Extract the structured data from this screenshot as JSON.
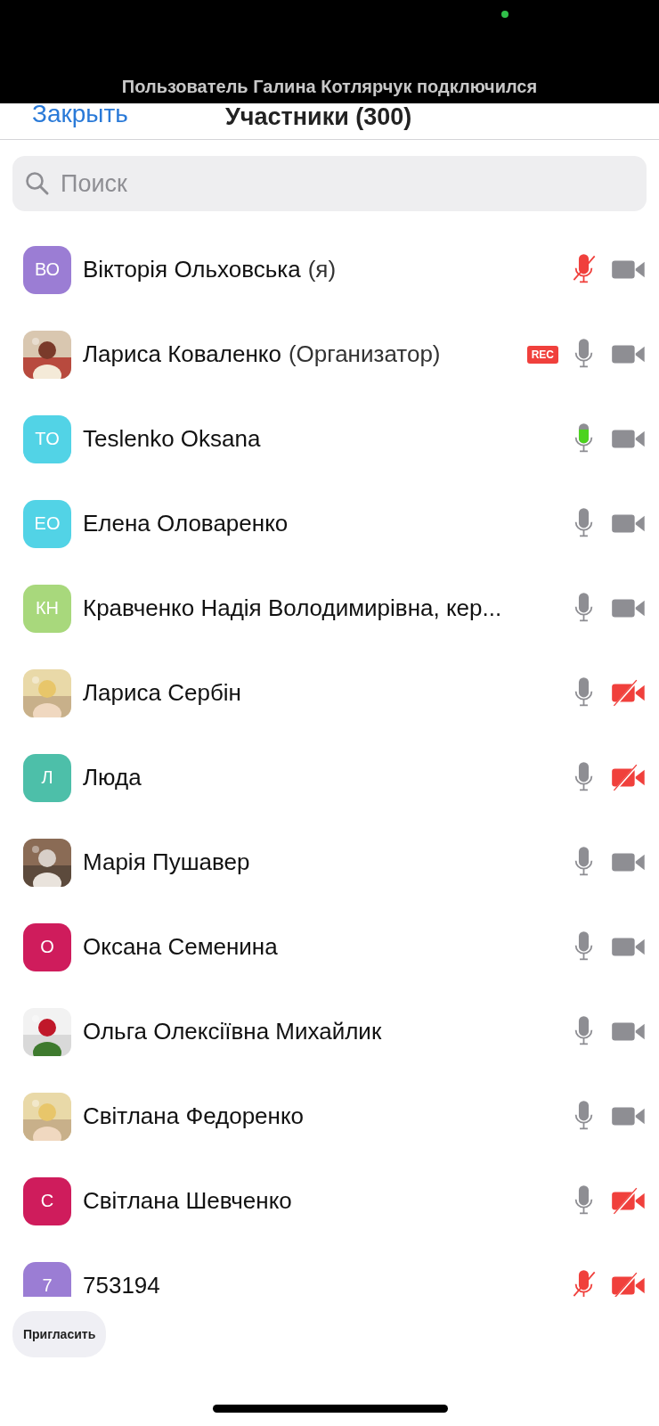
{
  "notification": {
    "text": "Пользователь Галина Котлярчук подключился"
  },
  "header": {
    "close": "Закрыть",
    "title": "Участники (300)"
  },
  "search": {
    "placeholder": "Поиск"
  },
  "participants": [
    {
      "avatar": {
        "kind": "initials",
        "text": "ВО",
        "color": "#9b7dd4"
      },
      "name": "Вікторія Ольховська",
      "role": "(я)",
      "recording": false,
      "muted": true,
      "talking": false,
      "video_on": true
    },
    {
      "name": "Лариса Коваленко",
      "role": "(Организатор)",
      "recording": true,
      "badge": "REC",
      "muted": false,
      "talking": false,
      "video_on": true
    },
    {
      "avatar": {
        "kind": "initials",
        "text": "TO",
        "color": "#52d3e6"
      },
      "name": "Teslenko Oksana",
      "recording": false,
      "muted": false,
      "talking": true,
      "video_on": true
    },
    {
      "avatar": {
        "kind": "initials",
        "text": "ЕО",
        "color": "#52d3e6"
      },
      "name": "Елена Оловаренко",
      "recording": false,
      "muted": false,
      "talking": false,
      "video_on": true
    },
    {
      "avatar": {
        "kind": "initials",
        "text": "КН",
        "color": "#a8d87c"
      },
      "name": "Кравченко Надія Володимирівна, кер...",
      "recording": false,
      "muted": false,
      "talking": false,
      "video_on": true
    },
    {
      "name": "Лариса Сербін",
      "recording": false,
      "muted": false,
      "talking": false,
      "video_on": false
    },
    {
      "avatar": {
        "kind": "initials",
        "text": "Л",
        "color": "#4dbfa9"
      },
      "name": "Люда",
      "recording": false,
      "muted": false,
      "talking": false,
      "video_on": false
    },
    {
      "name": "Марія Пушавер",
      "recording": false,
      "muted": false,
      "talking": false,
      "video_on": true
    },
    {
      "avatar": {
        "kind": "initials",
        "text": "О",
        "color": "#cf1c5c"
      },
      "name": "Оксана Семенина",
      "recording": false,
      "muted": false,
      "talking": false,
      "video_on": true
    },
    {
      "name": "Ольга Олексіївна Михайлик",
      "recording": false,
      "muted": false,
      "talking": false,
      "video_on": true
    },
    {
      "name": "Світлана Федоренко",
      "recording": false,
      "muted": false,
      "talking": false,
      "video_on": true
    },
    {
      "avatar": {
        "kind": "initials",
        "text": "С",
        "color": "#cf1c5c"
      },
      "name": "Світлана Шевченко",
      "recording": false,
      "muted": false,
      "talking": false,
      "video_on": false
    },
    {
      "avatar": {
        "kind": "initials",
        "text": "7",
        "color": "#9b7dd4"
      },
      "name": "753194",
      "recording": false,
      "muted": true,
      "talking": false,
      "video_on": false
    }
  ],
  "invite_button": "Пригласить"
}
